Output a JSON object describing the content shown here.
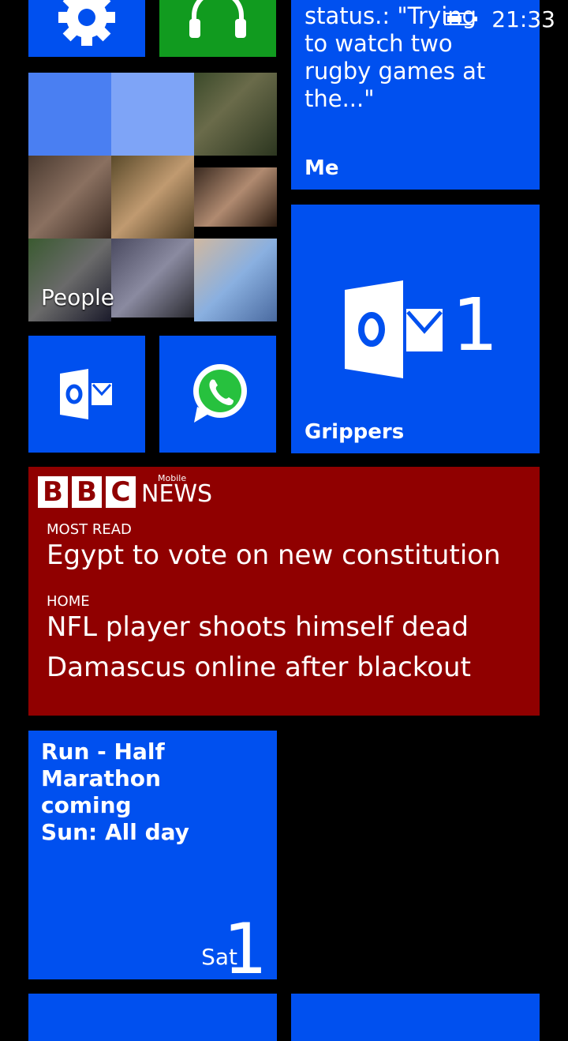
{
  "status_bar": {
    "time": "21:33",
    "battery_level": 0.6
  },
  "tiles": {
    "settings": {
      "icon": "gear-icon"
    },
    "music": {
      "icon": "headphones-icon"
    },
    "me": {
      "status": "status.: \"Trying to watch two rugby games at the...\"",
      "label": "Me"
    },
    "people": {
      "label": "People"
    },
    "outlook_small": {
      "icon": "outlook-icon"
    },
    "whatsapp": {
      "icon": "whatsapp-icon"
    },
    "grippers": {
      "label": "Grippers",
      "count": "1",
      "icon": "outlook-icon"
    },
    "bbc": {
      "logo_letters": [
        "B",
        "B",
        "C"
      ],
      "logo_news": "NEWS",
      "logo_mobile": "Mobile",
      "section1": "MOST READ",
      "headline1": "Egypt to vote on new constitution",
      "section2": "HOME",
      "headline2": "NFL player shoots himself dead",
      "headline3": "Damascus online after blackout"
    },
    "calendar": {
      "event_line1": "Run - Half Marathon",
      "event_line2": "coming",
      "event_line3": "Sun: All day",
      "day_name": "Sat",
      "day_number": "1"
    }
  },
  "colors": {
    "tile_blue": "#0050ef",
    "tile_green": "#119b1f",
    "bbc_red": "#900000"
  }
}
